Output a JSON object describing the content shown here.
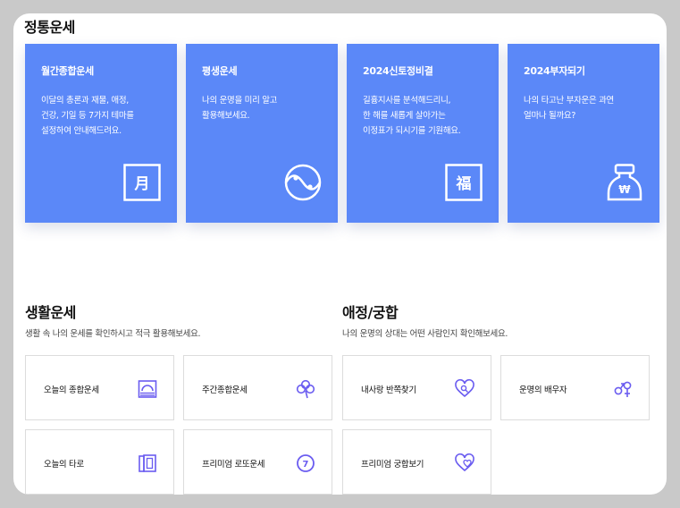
{
  "fortune": {
    "title": "정통운세",
    "cards": [
      {
        "title": "월간종합운세",
        "desc": "이달의 총론과 재물, 애정,\n건강, 기일 등 7가지 테마를\n설정하여 안내해드려요.",
        "icon": "calendar-month-icon",
        "glyph": "月"
      },
      {
        "title": "평생운세",
        "desc": "나의 운명을 미리 알고\n활용해보세요.",
        "icon": "yin-yang-icon"
      },
      {
        "title": "2024신토정비결",
        "desc": "길흉지사를 분석해드리니,\n한 해를 새롭게 살아가는\n이정표가 되시기를 기원해요.",
        "icon": "fortune-bok-icon",
        "glyph": "福"
      },
      {
        "title": "2024부자되기",
        "desc": "나의 타고난 부자운은 과연\n얼마나 될까요?",
        "icon": "money-bag-icon",
        "glyph": "₩"
      }
    ]
  },
  "life": {
    "title": "생활운세",
    "subtitle": "생활 속 나의 운세를 확인하시고 적극 활용해보세요.",
    "items": [
      {
        "label": "오늘의 종합운세",
        "icon": "sunrise-icon"
      },
      {
        "label": "주간종합운세",
        "icon": "clover-icon"
      },
      {
        "label": "오늘의 타로",
        "icon": "tarot-cards-icon"
      },
      {
        "label": "프리미엄 로또운세",
        "icon": "lotto-ball-icon",
        "glyph": "7"
      }
    ]
  },
  "love": {
    "title": "애정/궁합",
    "subtitle": "나의 운명의 상대는 어떤 사람인지 확인해보세요.",
    "items": [
      {
        "label": "내사랑 반쪽찾기",
        "icon": "heart-search-icon"
      },
      {
        "label": "운명의 배우자",
        "icon": "gender-symbols-icon"
      },
      {
        "label": "프리미엄 궁합보기",
        "icon": "double-heart-icon"
      }
    ]
  },
  "colors": {
    "card": "#5b88f8",
    "accent": "#6a5cf0"
  }
}
